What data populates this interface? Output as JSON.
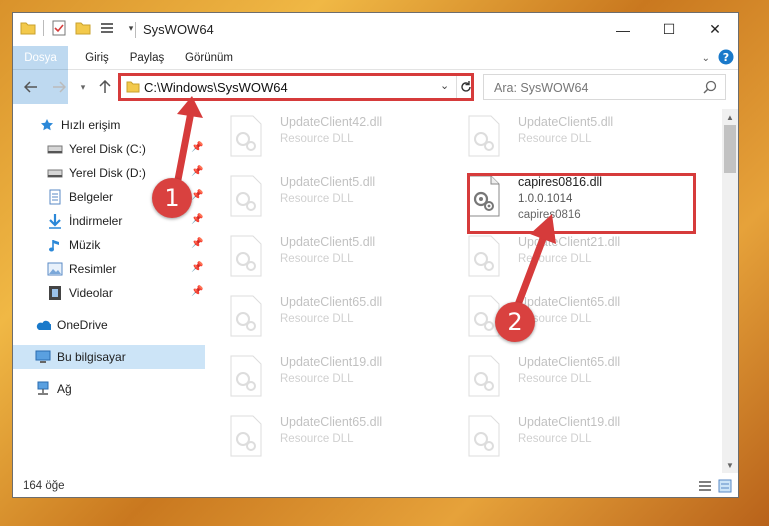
{
  "window": {
    "title": "SysWOW64",
    "controls": {
      "minimize": "—",
      "maximize": "☐",
      "close": "✕"
    }
  },
  "ribbon": {
    "tabs": [
      {
        "label": "Dosya"
      },
      {
        "label": "Giriş"
      },
      {
        "label": "Paylaş"
      },
      {
        "label": "Görünüm"
      }
    ]
  },
  "address": {
    "path": "C:\\Windows\\SysWOW64",
    "search_placeholder": "Ara: SysWOW64"
  },
  "nav": {
    "items": [
      {
        "label": "Hızlı erişim",
        "icon": "star-icon",
        "pinned": false
      },
      {
        "label": "Yerel Disk (C:)",
        "icon": "drive-icon",
        "pinned": true
      },
      {
        "label": "Yerel Disk (D:)",
        "icon": "drive-icon",
        "pinned": true
      },
      {
        "label": "Belgeler",
        "icon": "documents-icon",
        "pinned": true
      },
      {
        "label": "İndirmeler",
        "icon": "download-icon",
        "pinned": true
      },
      {
        "label": "Müzik",
        "icon": "music-icon",
        "pinned": true
      },
      {
        "label": "Resimler",
        "icon": "pictures-icon",
        "pinned": true
      },
      {
        "label": "Videolar",
        "icon": "videos-icon",
        "pinned": true
      },
      {
        "label": "OneDrive",
        "icon": "cloud-icon",
        "pinned": false
      },
      {
        "label": "Bu bilgisayar",
        "icon": "computer-icon",
        "pinned": false,
        "selected": true
      },
      {
        "label": "Ağ",
        "icon": "network-icon",
        "pinned": false
      }
    ]
  },
  "files": {
    "left_column": [
      {
        "name": "UpdateClient42.dll",
        "desc": "Resource DLL"
      },
      {
        "name": "UpdateClient5.dll",
        "desc": "Resource DLL"
      },
      {
        "name": "UpdateClient5.dll",
        "desc": "Resource DLL"
      },
      {
        "name": "UpdateClient65.dll",
        "desc": "Resource DLL"
      },
      {
        "name": "UpdateClient19.dll",
        "desc": "Resource DLL"
      },
      {
        "name": "UpdateClient65.dll",
        "desc": "Resource DLL"
      }
    ],
    "right_column": [
      {
        "name": "UpdateClient5.dll",
        "desc": "Resource DLL"
      },
      {
        "name": "capires0816.dll",
        "version": "1.0.0.1014",
        "desc": "capires0816",
        "highlight": true
      },
      {
        "name": "UpdateClient21.dll",
        "desc": "Resource DLL"
      },
      {
        "name": "UpdateClient65.dll",
        "desc": "Resource DLL"
      },
      {
        "name": "UpdateClient65.dll",
        "desc": "Resource DLL"
      },
      {
        "name": "UpdateClient19.dll",
        "desc": "Resource DLL"
      }
    ]
  },
  "status": {
    "item_count": "164 öğe"
  },
  "annotations": {
    "step1": "1",
    "step2": "2",
    "color": "#d63b3b"
  }
}
